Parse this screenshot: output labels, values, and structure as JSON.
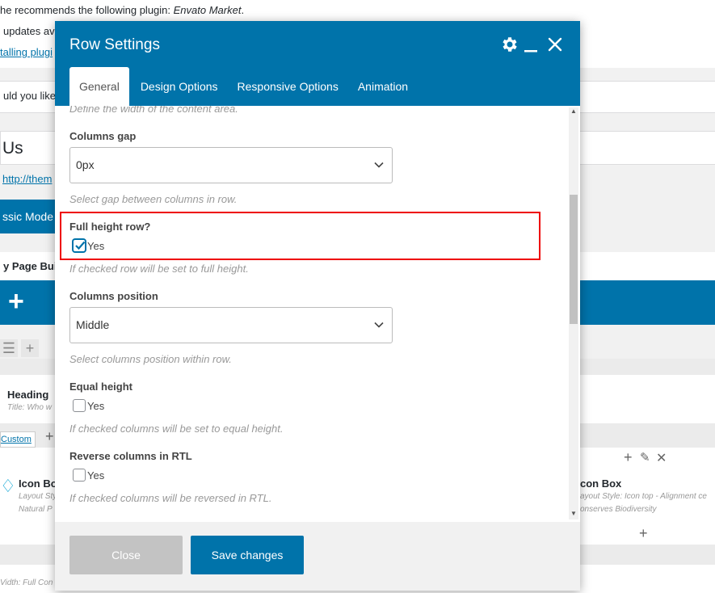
{
  "background": {
    "notice_line1_prefix": "he recommends the following plugin: ",
    "notice_line1_plugin": "Envato Market",
    "notice_line1_suffix": ".",
    "notice_line2": "updates av",
    "notice_link": "talling plugi",
    "question_text": "uld you like",
    "page_title": "Us",
    "permalink": "http://them",
    "classic_mode_label": "ssic Mode",
    "builder_label": "y Page Buil",
    "add_plus": "+",
    "heading_title": "Heading",
    "heading_sub": "Title: Who w",
    "custom_tag": "Custom",
    "icon_box_left_title": "Icon Bo",
    "icon_box_left_sub1": "Layout Styl",
    "icon_box_left_sub2": "Natural P",
    "icon_box_right_title": "con Box",
    "icon_box_right_sub1": "ayout Style: Icon top - Alignment ce",
    "icon_box_right_sub2": "onserves Biodiversity",
    "bottom_sub": "Vidth: Full  Con"
  },
  "modal": {
    "title": "Row Settings",
    "header_icons": [
      "gear-icon",
      "minimize-icon",
      "close-icon"
    ],
    "tabs": [
      {
        "label": "General",
        "active": true
      },
      {
        "label": "Design Options",
        "active": false
      },
      {
        "label": "Responsive Options",
        "active": false
      },
      {
        "label": "Animation",
        "active": false
      }
    ],
    "cut_help": "Define the width of the content area.",
    "fields": {
      "columns_gap": {
        "label": "Columns gap",
        "value": "0px",
        "help": "Select gap between columns in row."
      },
      "full_height": {
        "label": "Full height row?",
        "option": "Yes",
        "checked": true,
        "help": "If checked row will be set to full height."
      },
      "columns_position": {
        "label": "Columns position",
        "value": "Middle",
        "help": "Select columns position within row."
      },
      "equal_height": {
        "label": "Equal height",
        "option": "Yes",
        "checked": false,
        "help": "If checked columns will be set to equal height."
      },
      "reverse_rtl": {
        "label": "Reverse columns in RTL",
        "option": "Yes",
        "checked": false,
        "help": "If checked columns will be reversed in RTL."
      }
    },
    "footer": {
      "close_label": "Close",
      "save_label": "Save changes"
    }
  },
  "colors": {
    "accent": "#0073aa",
    "highlight": "#e00000",
    "disabled": "#c3c3c3"
  }
}
